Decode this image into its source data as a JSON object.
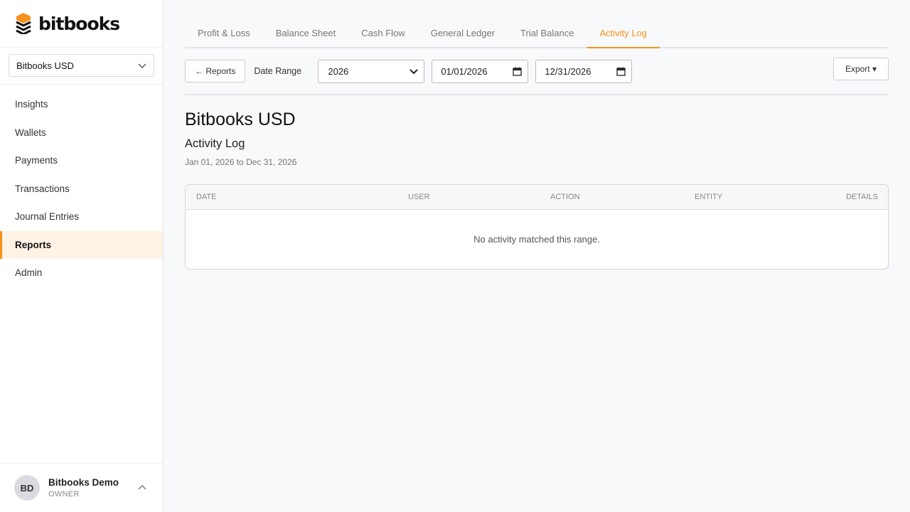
{
  "brand": {
    "name": "bitbooks"
  },
  "org_select": {
    "value": "Bitbooks USD"
  },
  "nav": {
    "items": [
      {
        "label": "Insights"
      },
      {
        "label": "Wallets"
      },
      {
        "label": "Payments"
      },
      {
        "label": "Transactions"
      },
      {
        "label": "Journal Entries"
      },
      {
        "label": "Reports",
        "active": true
      },
      {
        "label": "Admin"
      }
    ]
  },
  "user": {
    "initials": "BD",
    "name": "Bitbooks Demo",
    "role": "OWNER"
  },
  "tabs": [
    {
      "label": "Profit & Loss"
    },
    {
      "label": "Balance Sheet"
    },
    {
      "label": "Cash Flow"
    },
    {
      "label": "General Ledger"
    },
    {
      "label": "Trial Balance"
    },
    {
      "label": "Activity Log",
      "active": true
    }
  ],
  "toolbar": {
    "back_label": "← Reports",
    "date_range_label": "Date Range",
    "year_value": "2026",
    "start_date": "01/01/2026",
    "end_date": "12/31/2026",
    "export_label": "Export ▾"
  },
  "report": {
    "org_name": "Bitbooks USD",
    "title": "Activity Log",
    "range_text": "Jan 01, 2026 to Dec 31, 2026"
  },
  "table": {
    "columns": [
      "DATE",
      "USER",
      "ACTION",
      "ENTITY",
      "DETAILS"
    ],
    "empty_message": "No activity matched this range."
  },
  "colors": {
    "accent": "#f5921e",
    "active_nav_bg": "#fff3e6",
    "logo_dark": "#111111"
  },
  "icons": {
    "logo": "bitbooks-logo-icon",
    "org_chevron": "chevron-down-icon",
    "user_toggle": "chevron-up-icon",
    "select_chevron": "chevron-down-icon",
    "calendar": "calendar-icon"
  }
}
